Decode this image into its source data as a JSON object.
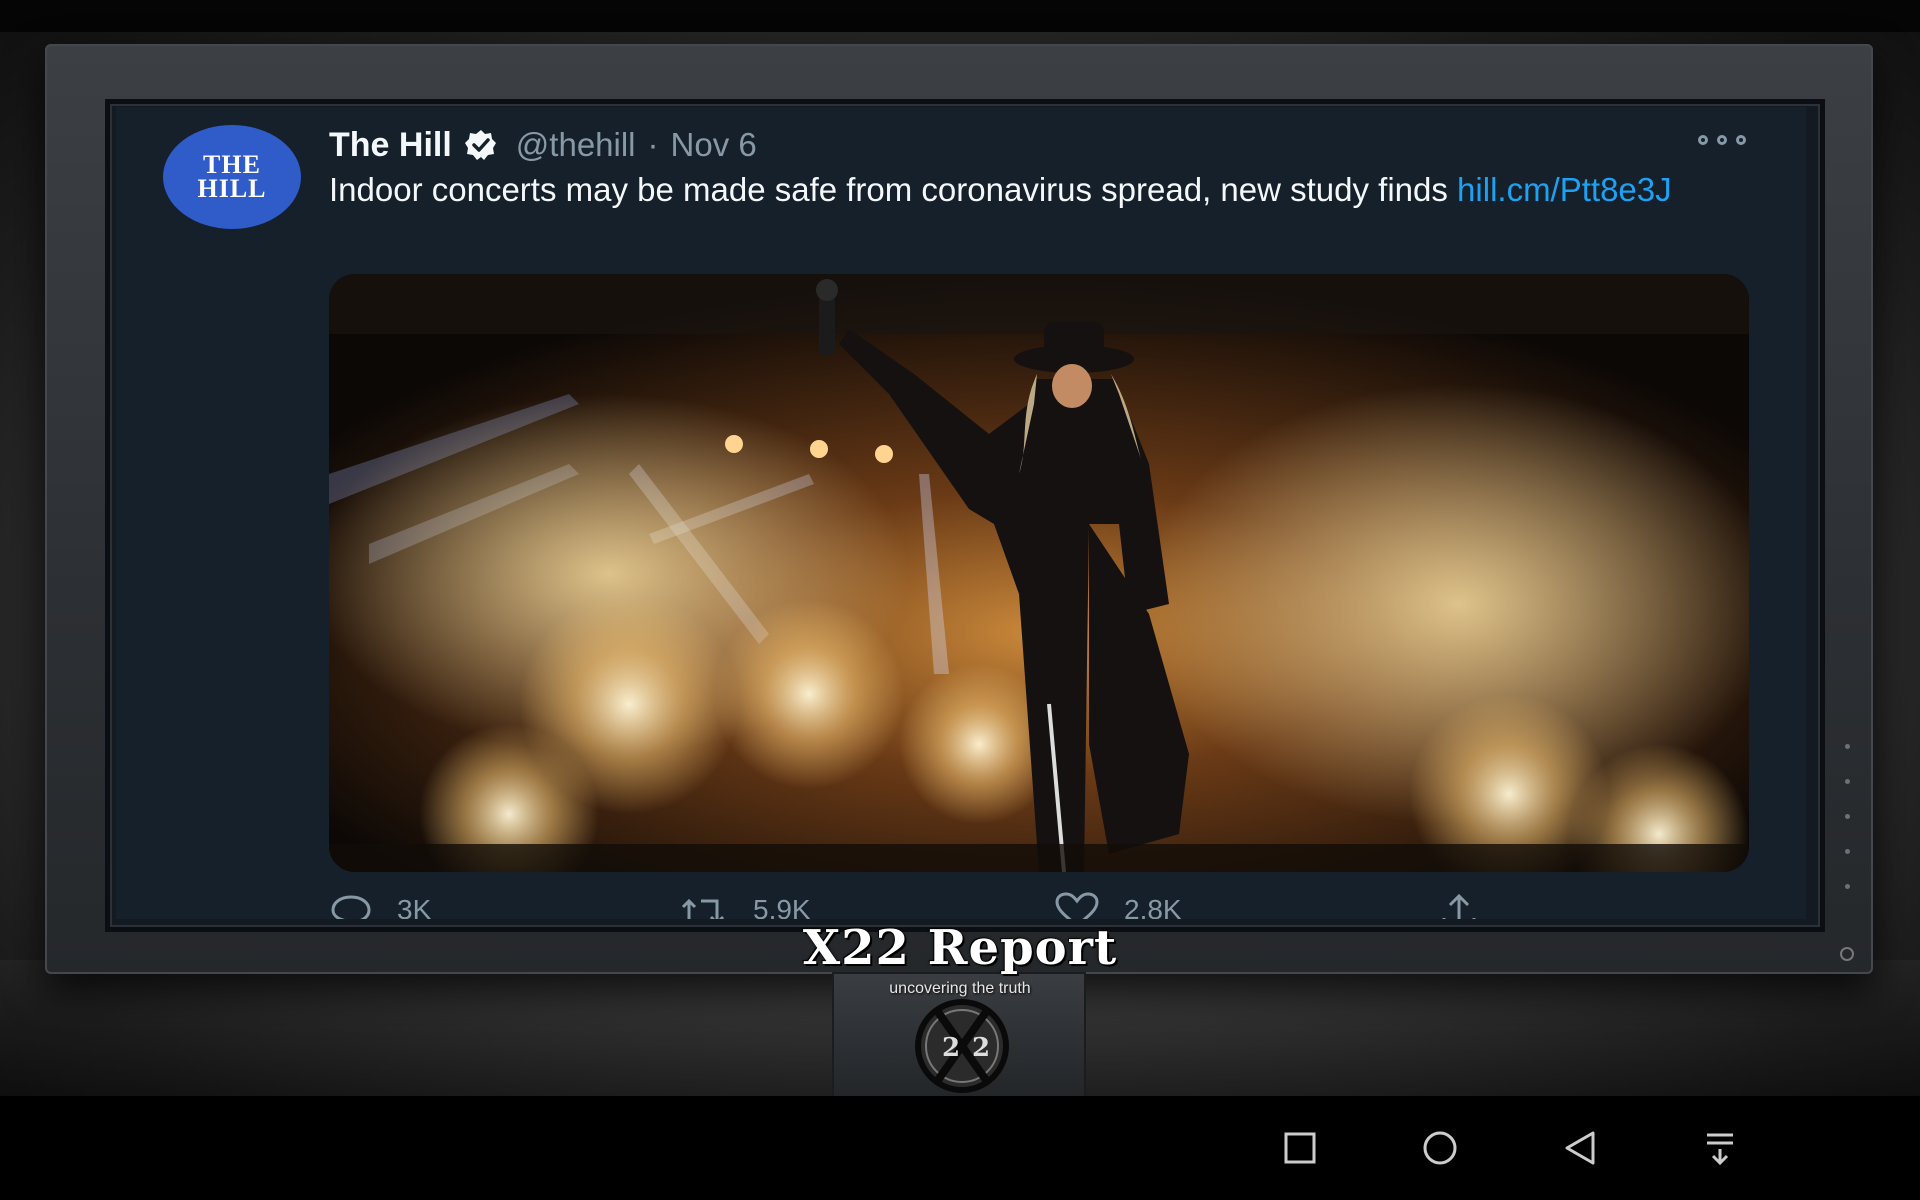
{
  "tweet": {
    "avatar_line1": "THE",
    "avatar_line2": "HILL",
    "name": "The Hill",
    "handle": "@thehill",
    "separator": "·",
    "date": "Nov 6",
    "text": "Indoor concerts may be made safe from coronavirus spread, new study finds ",
    "link": "hill.cm/Ptt8e3J",
    "replies": "3K",
    "retweets": "5.9K",
    "likes": "2.8K",
    "media_alt": "photo of a performer on stage with a microphone amid fireworks and sparks"
  },
  "brand": {
    "title": "X22 Report",
    "subtitle": "uncovering the truth",
    "logo_text": "2X2"
  },
  "navbar": {
    "buttons": [
      "recents-button",
      "home-button",
      "back-button",
      "notifications-button"
    ]
  },
  "colors": {
    "tweet_bg": "#15202b",
    "text": "#f5f8fa",
    "secondary_text": "#8899a6",
    "link": "#1da1f2",
    "avatar_bg": "#2f5cc9"
  }
}
